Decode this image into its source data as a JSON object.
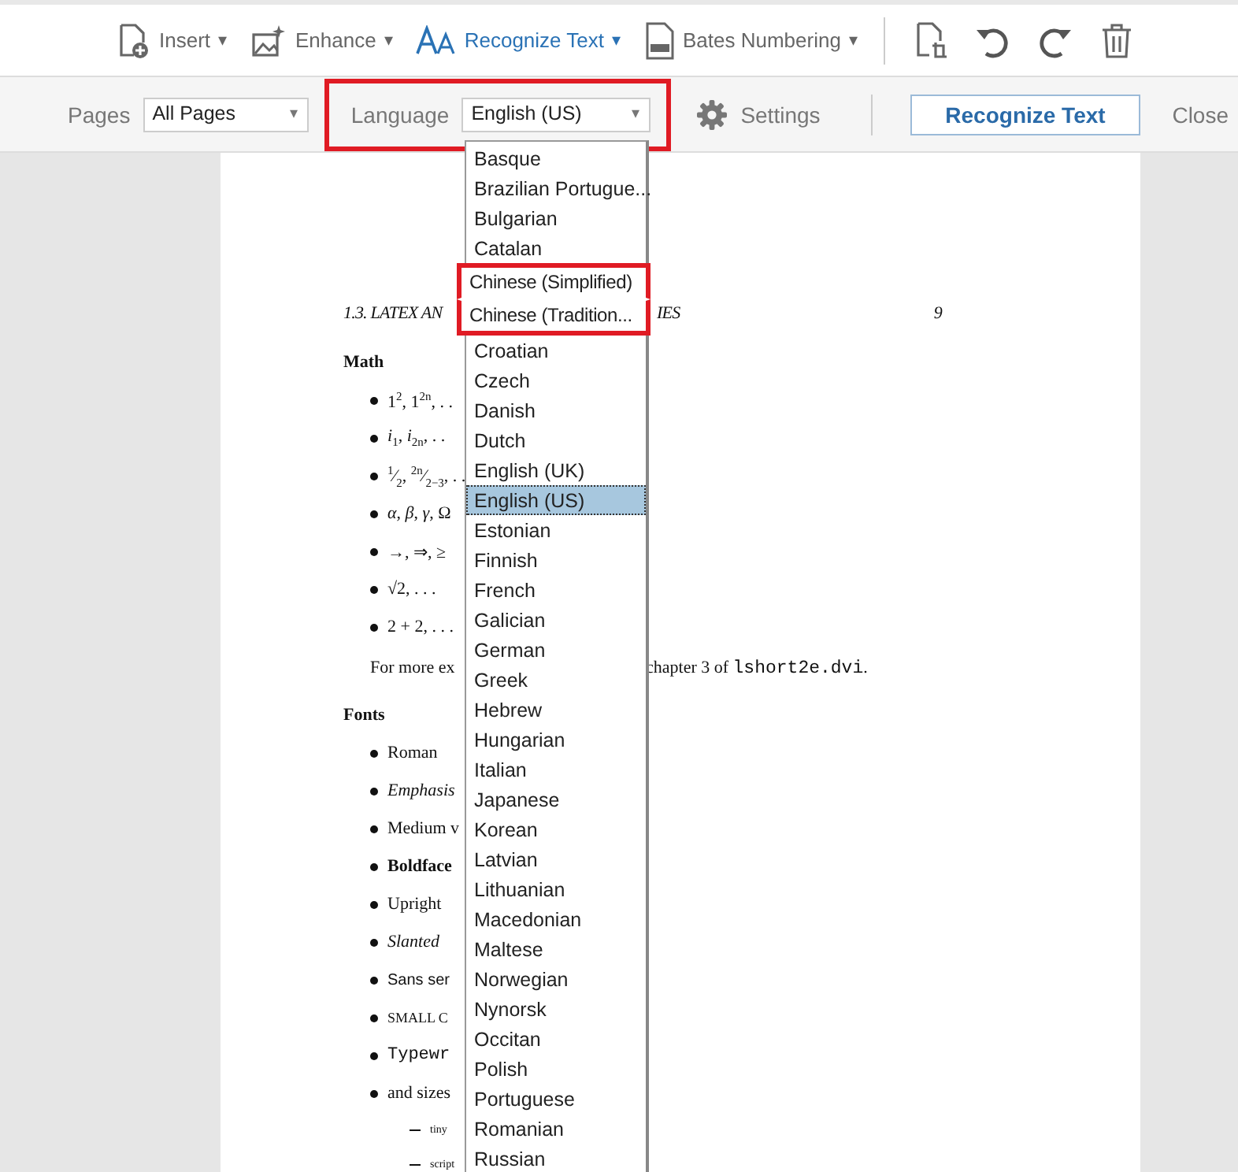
{
  "toolbar": {
    "items": [
      {
        "label": "Insert",
        "caret": "▾",
        "active": false
      },
      {
        "label": "Enhance",
        "caret": "▾",
        "active": false
      },
      {
        "label": "Recognize Text",
        "caret": "▾",
        "active": true
      },
      {
        "label": "Bates Numbering",
        "caret": "▾",
        "active": false
      }
    ]
  },
  "options_bar": {
    "pages_label": "Pages",
    "pages_value": "All Pages",
    "pages_caret": "▾",
    "language_label": "Language",
    "language_value": "English (US)",
    "language_caret": "▾",
    "language_highlighted": true,
    "settings": "Settings",
    "recognize_button": "Recognize Text",
    "close": "Close"
  },
  "language_list": {
    "items": [
      {
        "label": "Basque",
        "selected": false,
        "highlighted": false
      },
      {
        "label": "Brazilian Portugue...",
        "selected": false,
        "highlighted": false
      },
      {
        "label": "Bulgarian",
        "selected": false,
        "highlighted": false
      },
      {
        "label": "Catalan",
        "selected": false,
        "highlighted": false
      },
      {
        "label": "Chinese (Simplified)",
        "selected": false,
        "highlighted": true
      },
      {
        "label": "Chinese (Tradition...",
        "selected": false,
        "highlighted": true
      },
      {
        "label": "Croatian",
        "selected": false,
        "highlighted": false
      },
      {
        "label": "Czech",
        "selected": false,
        "highlighted": false
      },
      {
        "label": "Danish",
        "selected": false,
        "highlighted": false
      },
      {
        "label": "Dutch",
        "selected": false,
        "highlighted": false
      },
      {
        "label": "English (UK)",
        "selected": false,
        "highlighted": false
      },
      {
        "label": "English (US)",
        "selected": true,
        "highlighted": false
      },
      {
        "label": "Estonian",
        "selected": false,
        "highlighted": false
      },
      {
        "label": "Finnish",
        "selected": false,
        "highlighted": false
      },
      {
        "label": "French",
        "selected": false,
        "highlighted": false
      },
      {
        "label": "Galician",
        "selected": false,
        "highlighted": false
      },
      {
        "label": "German",
        "selected": false,
        "highlighted": false
      },
      {
        "label": "Greek",
        "selected": false,
        "highlighted": false
      },
      {
        "label": "Hebrew",
        "selected": false,
        "highlighted": false
      },
      {
        "label": "Hungarian",
        "selected": false,
        "highlighted": false
      },
      {
        "label": "Italian",
        "selected": false,
        "highlighted": false
      },
      {
        "label": "Japanese",
        "selected": false,
        "highlighted": false
      },
      {
        "label": "Korean",
        "selected": false,
        "highlighted": false
      },
      {
        "label": "Latvian",
        "selected": false,
        "highlighted": false
      },
      {
        "label": "Lithuanian",
        "selected": false,
        "highlighted": false
      },
      {
        "label": "Macedonian",
        "selected": false,
        "highlighted": false
      },
      {
        "label": "Maltese",
        "selected": false,
        "highlighted": false
      },
      {
        "label": "Norwegian",
        "selected": false,
        "highlighted": false
      },
      {
        "label": "Nynorsk",
        "selected": false,
        "highlighted": false
      },
      {
        "label": "Occitan",
        "selected": false,
        "highlighted": false
      },
      {
        "label": "Polish",
        "selected": false,
        "highlighted": false
      },
      {
        "label": "Portuguese",
        "selected": false,
        "highlighted": false
      },
      {
        "label": "Romanian",
        "selected": false,
        "highlighted": false
      },
      {
        "label": "Russian",
        "selected": false,
        "highlighted": false
      }
    ]
  },
  "document": {
    "lines": [
      {
        "kind": "heading",
        "left": "1.3.  LATEX AN",
        "right": "IES",
        "page_number": "9"
      },
      {
        "kind": "section",
        "left": "Math"
      },
      {
        "kind": "bullet",
        "left": "1$^{2}$, 1$^{2n}$, . ."
      },
      {
        "kind": "bullet",
        "left": "*i*$_{1}$, *i*$_{2n}$, . ."
      },
      {
        "kind": "bullet",
        "left": "$^{1}$⁄$_{2}$, $^{2n}$⁄$_{2−3}$, . ."
      },
      {
        "kind": "bullet",
        "left": "*α*, *β*, *γ*, Ω"
      },
      {
        "kind": "bullet",
        "left": "→, ⇒, ≥"
      },
      {
        "kind": "bullet",
        "left": "√2, . . ."
      },
      {
        "kind": "bullet",
        "left": "2 + 2, . . ."
      },
      {
        "kind": "para",
        "left": "For more ex",
        "right": "chapter 3 of ",
        "right_code": "lshort2e.dvi",
        "right_end": "."
      },
      {
        "kind": "section",
        "left": "Fonts"
      },
      {
        "kind": "bullet",
        "left": "Roman"
      },
      {
        "kind": "italic",
        "left": "Emphasis"
      },
      {
        "kind": "bullet",
        "left": "Medium v"
      },
      {
        "kind": "bold",
        "left": "Boldface"
      },
      {
        "kind": "bullet",
        "left": "Upright"
      },
      {
        "kind": "italic",
        "left": "Slanted"
      },
      {
        "kind": "sans",
        "left": "Sans ser"
      },
      {
        "kind": "smallcaps",
        "left": "SMALL C"
      },
      {
        "kind": "mono",
        "left": "Typewr"
      },
      {
        "kind": "bullet",
        "left": "and sizes"
      },
      {
        "kind": "sub",
        "left": "tiny"
      },
      {
        "kind": "sub",
        "left": "script"
      }
    ]
  }
}
